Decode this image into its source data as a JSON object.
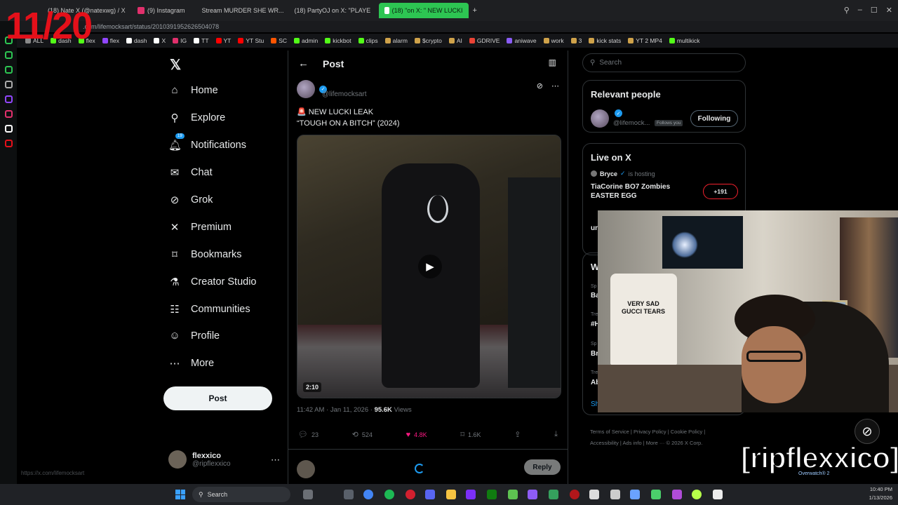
{
  "overlay": {
    "counter": "11/20",
    "stream_tag": "[ripflexxico]",
    "shirt_text": "VERY SAD GUCCI TEARS"
  },
  "browser": {
    "tabs": [
      {
        "label": "(18) Nate X (@natexwg) / X",
        "color": "#ffffff"
      },
      {
        "label": "(9) Instagram",
        "color": "#e1306c"
      },
      {
        "label": "Stream MURDER SHE WR...",
        "color": "#e4472f"
      },
      {
        "label": "(18) PartyOJ on X: \"PLAYE",
        "color": "#ffffff"
      },
      {
        "label": "(18) \"on X: \" NEW LUCKI",
        "color": "#ffffff",
        "active": true
      }
    ],
    "address": ".com/lifemocksart/status/2010391952626504078",
    "bookmarks": [
      {
        "label": "ALL",
        "color": "#8a8a8a"
      },
      {
        "label": "dash",
        "color": "#53fc18"
      },
      {
        "label": "flex",
        "color": "#53fc18"
      },
      {
        "label": "flex",
        "color": "#9146ff"
      },
      {
        "label": "dash",
        "color": "#ffffff"
      },
      {
        "label": "X",
        "color": "#ffffff"
      },
      {
        "label": "IG",
        "color": "#e1306c"
      },
      {
        "label": "TT",
        "color": "#ffffff"
      },
      {
        "label": "YT",
        "color": "#ff0000"
      },
      {
        "label": "YT Stu",
        "color": "#ff0000"
      },
      {
        "label": "SC",
        "color": "#ff5500"
      },
      {
        "label": "admin",
        "color": "#53fc18"
      },
      {
        "label": "kickbot",
        "color": "#53fc18"
      },
      {
        "label": "clips",
        "color": "#53fc18"
      },
      {
        "label": "alarm",
        "color": "#cfa24a"
      },
      {
        "label": "$crypto",
        "color": "#cfa24a"
      },
      {
        "label": "AI",
        "color": "#cfa24a"
      },
      {
        "label": "GDRIVE",
        "color": "#ea4335"
      },
      {
        "label": "aniwave",
        "color": "#8a5cf6"
      },
      {
        "label": "work",
        "color": "#cfa24a"
      },
      {
        "label": "3",
        "color": "#cfa24a"
      },
      {
        "label": "kick stats",
        "color": "#cfa24a"
      },
      {
        "label": "YT 2 MP4",
        "color": "#cfa24a"
      },
      {
        "label": "multikick",
        "color": "#53fc18"
      }
    ]
  },
  "nav": {
    "items": [
      {
        "label": "Home",
        "icon": "home-icon",
        "glyph": "⌂"
      },
      {
        "label": "Explore",
        "icon": "search-icon",
        "glyph": "⚲"
      },
      {
        "label": "Notifications",
        "icon": "bell-icon",
        "glyph": "🔔︎",
        "badge": "19"
      },
      {
        "label": "Chat",
        "icon": "mail-icon",
        "glyph": "✉"
      },
      {
        "label": "Grok",
        "icon": "grok-icon",
        "glyph": "⊘"
      },
      {
        "label": "Premium",
        "icon": "x-icon",
        "glyph": "✕"
      },
      {
        "label": "Bookmarks",
        "icon": "bookmark-icon",
        "glyph": "⌑"
      },
      {
        "label": "Creator Studio",
        "icon": "flask-icon",
        "glyph": "⚗"
      },
      {
        "label": "Communities",
        "icon": "people-icon",
        "glyph": "☷"
      },
      {
        "label": "Profile",
        "icon": "person-icon",
        "glyph": "☺"
      },
      {
        "label": "More",
        "icon": "more-icon",
        "glyph": "⋯"
      }
    ],
    "post_button": "Post",
    "account": {
      "name": "flexxico",
      "handle": "@ripflexxico"
    }
  },
  "post": {
    "header": "Post",
    "author_handle": "@lifemocksart",
    "text_line1": "🚨 NEW LUCKI LEAK",
    "text_line2": "“TOUGH ON A BITCH” (2024)",
    "duration": "2:10",
    "timestamp": "11:42 AM · Jan 11, 2026 · ",
    "views_count": "95.6K",
    "views_label": " Views",
    "replies": "23",
    "reposts": "524",
    "likes": "4.8K",
    "bookmarks": "1.6K",
    "reply_button": "Reply"
  },
  "right": {
    "search_placeholder": "Search",
    "relevant": {
      "title": "Relevant people",
      "handle": "@lifemock...",
      "follows_you": "Follows you",
      "follow_button": "Following"
    },
    "live": {
      "title": "Live on X",
      "host_name": "Bryce",
      "host_status": "is hosting",
      "event_title": "TiaCorine BO7 Zombies EASTER EGG",
      "listeners": "+191",
      "next_item": "un"
    },
    "whats": {
      "title": "W",
      "items": [
        "Ba",
        "#H",
        "Br",
        "Ab"
      ],
      "subs": [
        "Sp",
        "Tre",
        "Sp",
        "Tre"
      ],
      "show_more": "Sh"
    },
    "footer_line1": "Terms of Service  |  Privacy Policy  |  Cookie Policy  |",
    "footer_line2": "Accessibility  |  Ads info  |  More ···  © 2026 X Corp."
  },
  "status_url": "https://x.com/lifemocksart",
  "taskbar": {
    "search": "Search",
    "time": "10:40 PM",
    "date": "1/13/2026",
    "tray_label": "Overwatch® 2"
  }
}
